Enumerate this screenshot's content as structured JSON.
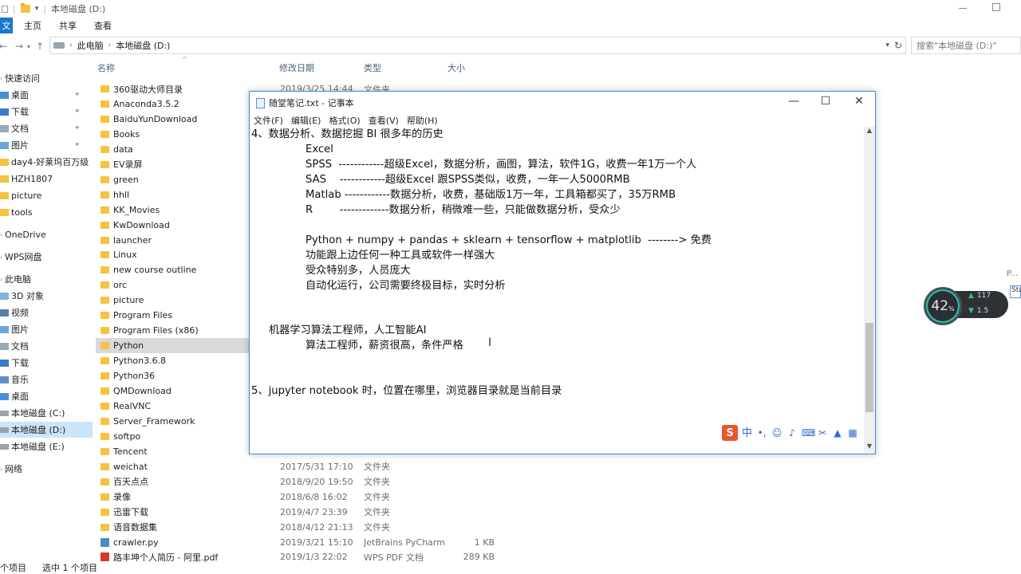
{
  "titlebar": {
    "title": "本地磁盘 (D:)"
  },
  "ribbon": {
    "file_tab": "文",
    "tabs": [
      "主页",
      "共享",
      "查看"
    ]
  },
  "address": {
    "crumbs": [
      "此电脑",
      "本地磁盘 (D:)"
    ],
    "search_placeholder": "搜索\"本地磁盘 (D:)\""
  },
  "sidebar": {
    "items": [
      {
        "label": "快速访问",
        "pinned": false
      },
      {
        "label": "桌面",
        "pinned": true
      },
      {
        "label": "下载",
        "pinned": true
      },
      {
        "label": "文档",
        "pinned": true
      },
      {
        "label": "图片",
        "pinned": true
      },
      {
        "label": "day4-好莱坞百万级",
        "pinned": false
      },
      {
        "label": "HZH1807",
        "pinned": false
      },
      {
        "label": "picture",
        "pinned": false
      },
      {
        "label": "tools",
        "pinned": false
      },
      {
        "label": "OneDrive",
        "pinned": false
      },
      {
        "label": "WPS网盘",
        "pinned": false
      },
      {
        "label": "此电脑",
        "pinned": false
      },
      {
        "label": "3D 对象",
        "pinned": false
      },
      {
        "label": "视频",
        "pinned": false
      },
      {
        "label": "图片",
        "pinned": false
      },
      {
        "label": "文档",
        "pinned": false
      },
      {
        "label": "下载",
        "pinned": false
      },
      {
        "label": "音乐",
        "pinned": false
      },
      {
        "label": "桌面",
        "pinned": false
      },
      {
        "label": "本地磁盘 (C:)",
        "pinned": false
      },
      {
        "label": "本地磁盘 (D:)",
        "pinned": false
      },
      {
        "label": "本地磁盘 (E:)",
        "pinned": false
      },
      {
        "label": "网络",
        "pinned": false
      }
    ]
  },
  "columns": {
    "name": "名称",
    "modified": "修改日期",
    "type": "类型",
    "size": "大小"
  },
  "files": [
    {
      "name": "360驱动大师目录",
      "date": "2019/3/25 14:44",
      "type": "文件夹",
      "size": "",
      "icon": "folder"
    },
    {
      "name": "Anaconda3.5.2",
      "date": "",
      "type": "",
      "size": "",
      "icon": "folder"
    },
    {
      "name": "BaiduYunDownload",
      "date": "",
      "type": "",
      "size": "",
      "icon": "folder"
    },
    {
      "name": "Books",
      "date": "",
      "type": "",
      "size": "",
      "icon": "folder"
    },
    {
      "name": "data",
      "date": "",
      "type": "",
      "size": "",
      "icon": "folder"
    },
    {
      "name": "EV录屏",
      "date": "",
      "type": "",
      "size": "",
      "icon": "folder"
    },
    {
      "name": "green",
      "date": "",
      "type": "",
      "size": "",
      "icon": "folder"
    },
    {
      "name": "hhll",
      "date": "",
      "type": "",
      "size": "",
      "icon": "folder"
    },
    {
      "name": "KK_Movies",
      "date": "",
      "type": "",
      "size": "",
      "icon": "folder"
    },
    {
      "name": "KwDownload",
      "date": "",
      "type": "",
      "size": "",
      "icon": "folder"
    },
    {
      "name": "launcher",
      "date": "",
      "type": "",
      "size": "",
      "icon": "folder"
    },
    {
      "name": "Linux",
      "date": "",
      "type": "",
      "size": "",
      "icon": "folder"
    },
    {
      "name": "new course outline",
      "date": "",
      "type": "",
      "size": "",
      "icon": "folder"
    },
    {
      "name": "orc",
      "date": "",
      "type": "",
      "size": "",
      "icon": "folder"
    },
    {
      "name": "picture",
      "date": "",
      "type": "",
      "size": "",
      "icon": "folder"
    },
    {
      "name": "Program Files",
      "date": "",
      "type": "",
      "size": "",
      "icon": "folder"
    },
    {
      "name": "Program Files (x86)",
      "date": "",
      "type": "",
      "size": "",
      "icon": "folder"
    },
    {
      "name": "Python",
      "date": "",
      "type": "",
      "size": "",
      "icon": "folder"
    },
    {
      "name": "Python3.6.8",
      "date": "",
      "type": "",
      "size": "",
      "icon": "folder"
    },
    {
      "name": "Python36",
      "date": "",
      "type": "",
      "size": "",
      "icon": "folder"
    },
    {
      "name": "QMDownload",
      "date": "",
      "type": "",
      "size": "",
      "icon": "folder"
    },
    {
      "name": "RealVNC",
      "date": "",
      "type": "",
      "size": "",
      "icon": "folder"
    },
    {
      "name": "Server_Framework",
      "date": "",
      "type": "",
      "size": "",
      "icon": "folder"
    },
    {
      "name": "softpo",
      "date": "",
      "type": "",
      "size": "",
      "icon": "folder"
    },
    {
      "name": "Tencent",
      "date": "",
      "type": "",
      "size": "",
      "icon": "folder"
    },
    {
      "name": "weichat",
      "date": "2017/5/31 17:10",
      "type": "文件夹",
      "size": "",
      "icon": "folder"
    },
    {
      "name": "百天点点",
      "date": "2018/9/20 19:50",
      "type": "文件夹",
      "size": "",
      "icon": "folder"
    },
    {
      "name": "录像",
      "date": "2018/6/8 16:02",
      "type": "文件夹",
      "size": "",
      "icon": "folder"
    },
    {
      "name": "迅雷下载",
      "date": "2019/4/7 23:39",
      "type": "文件夹",
      "size": "",
      "icon": "folder"
    },
    {
      "name": "语音数据集",
      "date": "2018/4/12 21:13",
      "type": "文件夹",
      "size": "",
      "icon": "folder"
    },
    {
      "name": "crawler.py",
      "date": "2019/3/21 15:10",
      "type": "JetBrains PyCharm",
      "size": "1 KB",
      "icon": "py"
    },
    {
      "name": "路丰坤个人简历 - 阿里.pdf",
      "date": "2019/1/3 22:02",
      "type": "WPS PDF 文档",
      "size": "289 KB",
      "icon": "pdf"
    }
  ],
  "statusbar": {
    "count": "个项目",
    "selected": "选中 1 个项目"
  },
  "notepad": {
    "title": "随堂笔记.txt - 记事本",
    "menu": [
      "文件(F)",
      "编辑(E)",
      "格式(O)",
      "查看(V)",
      "帮助(H)"
    ],
    "lines": [
      "4、数据分析、数据挖掘 BI 很多年的历史",
      "Excel",
      "SPSS  ------------超级Excel，数据分析，画图，算法，软件1G，收费一年1万一个人",
      "SAS    ------------超级Excel 跟SPSS类似，收费，一年一人5000RMB",
      "Matlab ------------数据分析，收费，基础版1万一年，工具箱都买了，35万RMB",
      "R        -------------数据分析，稍微难一些，只能做数据分析，受众少",
      "",
      "Python + numpy + pandas + sklearn + tensorflow + matplotlib  --------> 免费",
      "功能跟上边任何一种工具或软件一样强大",
      "受众特别多，人员庞大",
      "自动化运行，公司需要终极目标，实时分析",
      "",
      "",
      "机器学习算法工程师，人工智能AI",
      "算法工程师，薪资很高，条件严格",
      "",
      "",
      "5、jupyter notebook 时，位置在哪里，浏览器目录就是当前目录"
    ],
    "ime": {
      "logo": "S",
      "mode": "中"
    }
  },
  "netwidget": {
    "percent": "42",
    "unit": "%",
    "upload": "117",
    "download": "1.5"
  },
  "right_edge": {
    "label1": "P...",
    "label2": "Sta"
  }
}
